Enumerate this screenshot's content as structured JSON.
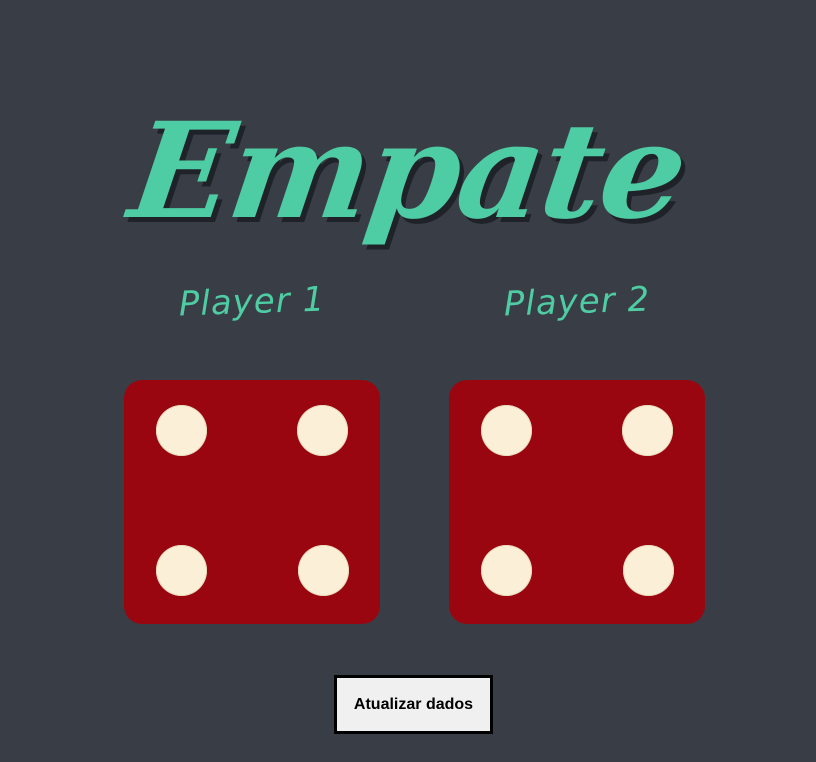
{
  "title": "Empate",
  "players": [
    {
      "label": "Player 1",
      "die_value": 4
    },
    {
      "label": "Player 2",
      "die_value": 4
    }
  ],
  "button": {
    "label": "Atualizar dados"
  },
  "colors": {
    "background": "#393E46",
    "accent": "#4ECCA3",
    "die_face": "#9A0610",
    "pip": "#FBEFD7"
  }
}
